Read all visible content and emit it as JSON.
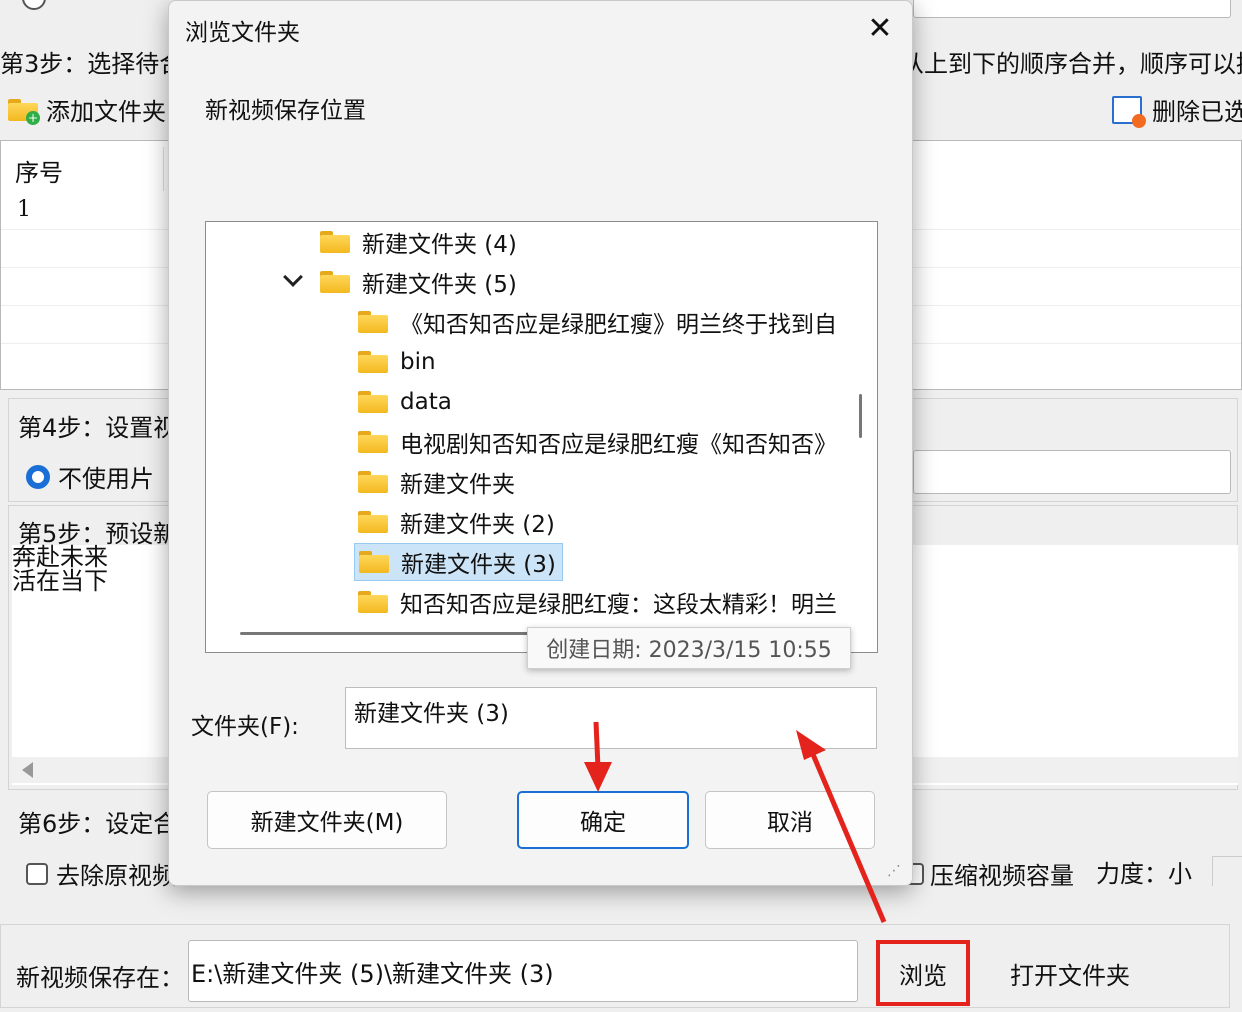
{
  "background": {
    "step3_label": "第3步：选择待合",
    "step3_right": "从上到下的顺序合并，顺序可以拖",
    "add_folder_label": "添加文件夹",
    "delete_selected_label": "删除已选",
    "table_header": "序号",
    "table_row_1": "1",
    "step4_label": "第4步：设置视",
    "no_segment_label": "不使用片",
    "step5_label": "第5步：预设新",
    "preset_line1": "奔赴未来",
    "preset_line2": "活在当下",
    "step6_label": "第6步：设定合",
    "remove_original_label": "去除原视频",
    "compress_label": "压缩视频容量",
    "strength_label": "力度：小",
    "save_path_label": "新视频保存在：",
    "save_path_value": "E:\\新建文件夹 (5)\\新建文件夹 (3)",
    "browse_button": "浏览",
    "open_folder_button": "打开文件夹"
  },
  "dialog": {
    "title": "浏览文件夹",
    "description": "新视频保存位置",
    "tree": [
      {
        "label": "新建文件夹 (4)",
        "expanded": false,
        "selected": false
      },
      {
        "label": "新建文件夹 (5)",
        "expanded": true,
        "selected": false
      },
      {
        "label": "《知否知否应是绿肥红瘦》明兰终于找到自",
        "selected": false
      },
      {
        "label": "bin",
        "selected": false
      },
      {
        "label": "data",
        "selected": false
      },
      {
        "label": "电视剧知否知否应是绿肥红瘦《知否知否》",
        "selected": false
      },
      {
        "label": "新建文件夹",
        "selected": false
      },
      {
        "label": "新建文件夹 (2)",
        "selected": false
      },
      {
        "label": "新建文件夹 (3)",
        "selected": true
      },
      {
        "label": "知否知否应是绿肥红瘦：这段太精彩！明兰",
        "selected": false
      }
    ],
    "tooltip": "创建日期: 2023/3/15 10:55",
    "folder_label": "文件夹(F):",
    "folder_value": "新建文件夹 (3)",
    "new_folder_button": "新建文件夹(M)",
    "ok_button": "确定",
    "cancel_button": "取消"
  },
  "colors": {
    "accent_blue": "#1a6fd6",
    "selection_bg": "#cce4f7",
    "annotation_red": "#e3231c"
  }
}
